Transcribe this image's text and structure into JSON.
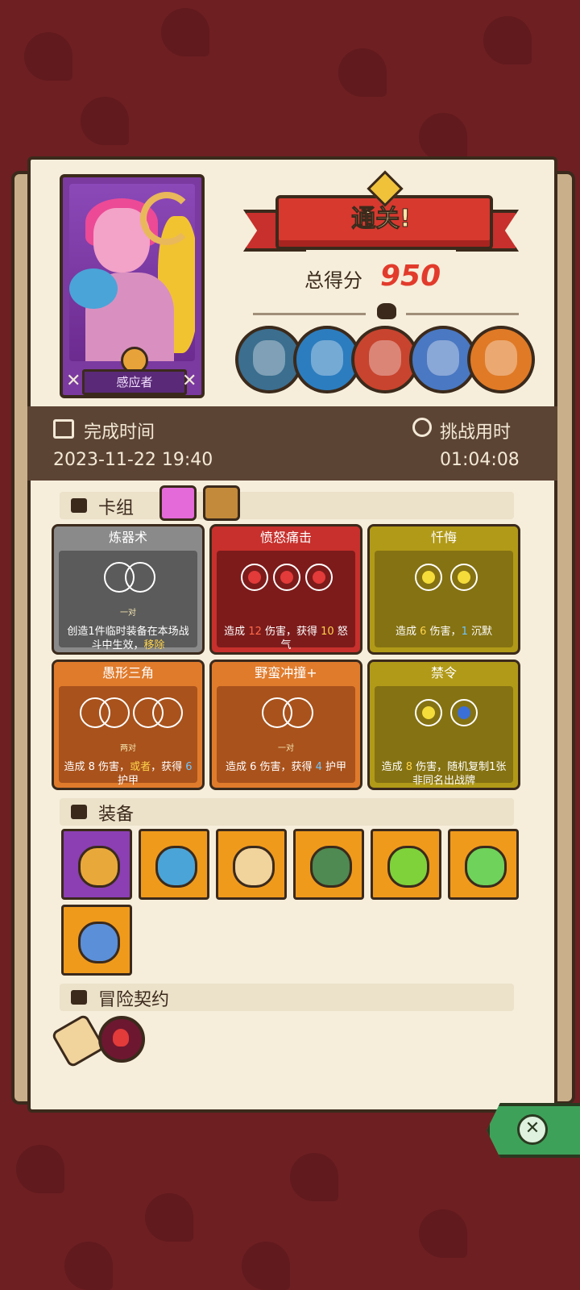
{
  "hero": {
    "name": "感应者"
  },
  "result": {
    "banner": "通关!",
    "score_label": "总得分",
    "score_value": "950"
  },
  "info": {
    "complete_label": "完成时间",
    "complete_value": "2023-11-22 19:40",
    "challenge_label": "挑战用时",
    "challenge_value": "01:04:08"
  },
  "deck": {
    "section_label": "卡组",
    "cards": [
      {
        "name": "炼器术",
        "sub": "一对",
        "desc": "创造1件临时装备在本场战斗中生效，",
        "desc_hl": "移除"
      },
      {
        "name": "愤怒痛击",
        "desc": "造成 ",
        "dmg": "12",
        "desc2": " 伤害，获得 ",
        "gain": "10",
        "desc3": " 怒气"
      },
      {
        "name": "忏悔",
        "desc": "造成 ",
        "dmg": "6",
        "desc2": " 伤害，",
        "gain": "1",
        "desc3": " 沉默"
      },
      {
        "name": "愚形三角",
        "sub": "两对",
        "desc": "造成 ",
        "dmg": "8",
        "desc2": " 伤害，",
        "hl": "或者",
        "desc3": "，获得 ",
        "gain": "6",
        "desc4": " 护甲"
      },
      {
        "name": "野蛮冲撞+",
        "sub": "一对",
        "desc": "造成 ",
        "dmg": "6",
        "desc2": " 伤害，获得 ",
        "gain": "4",
        "desc3": " 护甲"
      },
      {
        "name": "禁令",
        "desc": "造成 ",
        "dmg": "8",
        "desc2": " 伤害，随机复制1张非同名出战牌"
      }
    ]
  },
  "equipment": {
    "section_label": "装备",
    "items": [
      "ring-icon",
      "shield-icon",
      "bag-icon",
      "turtle-shell-icon",
      "potion-icon",
      "feather-icon",
      "axe-icon"
    ]
  },
  "contract": {
    "section_label": "冒险契约"
  },
  "colors": {
    "accent": "#e23b2c",
    "panel": "#f6eedb",
    "strip": "#5c4434"
  }
}
